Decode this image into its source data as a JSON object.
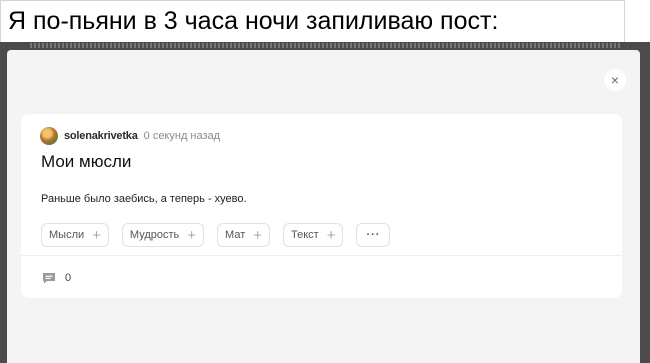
{
  "caption": {
    "text": "Я по-пьяни в 3 часа ночи запиливаю пост:"
  },
  "modal": {
    "close_symbol": "×"
  },
  "post": {
    "author": "solenakrivetka",
    "time": "0 секунд назад",
    "title": "Мои мюсли",
    "text": "Раньше было заебись, а теперь - хуево.",
    "tags": [
      {
        "label": "Мысли"
      },
      {
        "label": "Мудрость"
      },
      {
        "label": "Мат"
      },
      {
        "label": "Текст"
      }
    ],
    "more_label": "···",
    "comments_count": "0"
  },
  "icons": {
    "close": "close-icon",
    "avatar": "avatar",
    "tag_add": "plus-icon",
    "comments": "comment-icon"
  },
  "colors": {
    "backdrop": "#4b4b4b",
    "modal_bg": "#f4f4f5",
    "card_bg": "#ffffff",
    "tag_border": "#e2e2e2"
  }
}
